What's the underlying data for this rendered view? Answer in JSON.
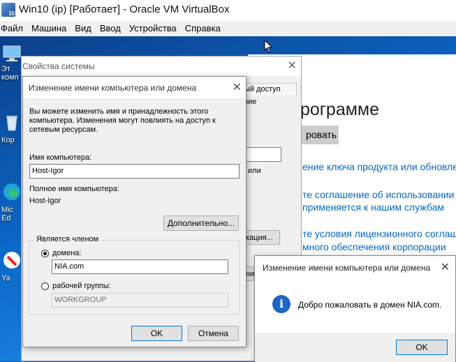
{
  "vbox": {
    "title": "Win10 (ip) [Работает] - Oracle VM VirtualBox",
    "icon_text": "10",
    "menu": [
      "Файл",
      "Машина",
      "Вид",
      "Ввод",
      "Устройства",
      "Справка"
    ]
  },
  "desktop": {
    "icons": [
      {
        "label": "Эт\nкомп",
        "icon": "computer-icon"
      },
      {
        "label": "Кор",
        "icon": "recycle-bin-icon"
      },
      {
        "label": "Mic\nEd",
        "icon": "edge-icon"
      },
      {
        "label": "Ya",
        "icon": "yandex-icon"
      }
    ]
  },
  "about_window": {
    "heading": "рограмме",
    "button": "ровать",
    "links": [
      "ение ключа продукта или обновлен",
      "те соглашение об использовании с",
      " применяется к нашим службам",
      "те условия лицензионного соглаше",
      "много обеспечения корпорации"
    ]
  },
  "system_properties": {
    "title": "Свойства системы",
    "tab_fragment": "ый доступ",
    "desc_fragment": "ние",
    "label_fragment": "или",
    "button_fragment": "кация...",
    "button2_fragment": "ни"
  },
  "rename_dialog": {
    "title": "Изменение имени компьютера или домена",
    "description": "Вы можете изменить имя и принадлежность этого компьютера. Изменения могут повлиять на доступ к сетевым ресурсам.",
    "computer_name_label": "Имя компьютера:",
    "computer_name_value": "Host-Igor",
    "full_name_label": "Полное имя компьютера:",
    "full_name_value": "Host-Igor",
    "more_button": "Дополнительно...",
    "member_of_caption": "Является членом",
    "domain_label": "домена:",
    "domain_value": "NIA.com",
    "workgroup_label": "рабочей группы:",
    "workgroup_value": "WORKGROUP",
    "ok": "OK",
    "cancel": "Отмена",
    "selected": "domain"
  },
  "welcome_box": {
    "title": "Изменение имени компьютера или домена",
    "message": "Добро пожаловать в домен NIA.com.",
    "ok": "OK"
  }
}
